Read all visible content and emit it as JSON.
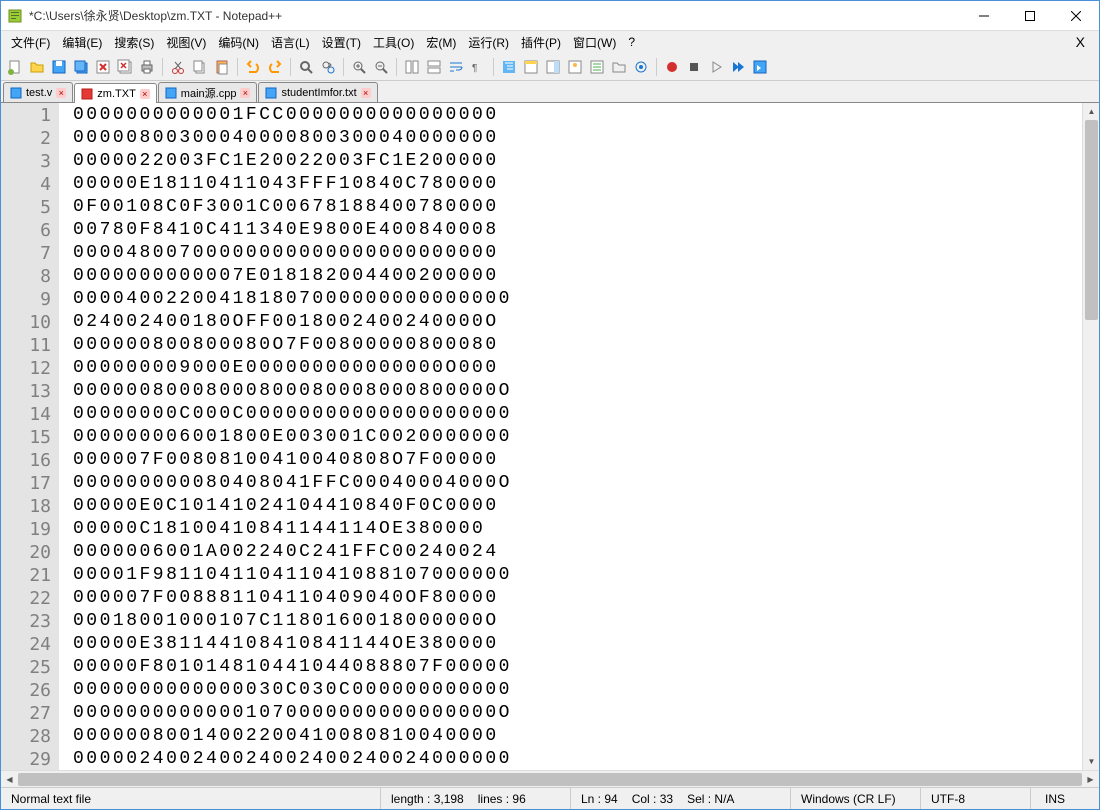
{
  "window": {
    "title": "*C:\\Users\\徐永贤\\Desktop\\zm.TXT - Notepad++"
  },
  "menu": {
    "items": [
      "文件(F)",
      "编辑(E)",
      "搜索(S)",
      "视图(V)",
      "编码(N)",
      "语言(L)",
      "设置(T)",
      "工具(O)",
      "宏(M)",
      "运行(R)",
      "插件(P)",
      "窗口(W)",
      "?"
    ]
  },
  "tabs": [
    {
      "label": "test.v",
      "active": false
    },
    {
      "label": "zm.TXT",
      "active": true
    },
    {
      "label": "main源.cpp",
      "active": false
    },
    {
      "label": "studentImfor.txt",
      "active": false
    }
  ],
  "editor": {
    "lines": [
      "0000000000001FCC0000000000000000",
      "00000800300040000800300040000000",
      "0000022003FC1E20022003FC1E200000",
      "00000E18110411043FFF10840C780000",
      "0F00108C0F3001C00678188400780000",
      "00780F8410C411340E9800E400840008",
      "00004800700000000000000000000000",
      "0000000000007E018182004400200000",
      "000040022004181807000000000000000",
      "024002400180OFF0018002400240000O",
      "000000800800080O7F00800000800080",
      "000000009000E000000000000000O000",
      "00000080008000800080008000800000O",
      "00000000C000C00000000000000000000",
      "000000006001800E003001C0020000000",
      "000007F00808100410040808O7F00000",
      "000000000080408041FFC00040004000O",
      "00000E0C10141024104410840F0C0000",
      "00000C18100410841144114OE380000",
      "0000006001A002240C241FFC00240024",
      "00001F981104110411041088107000000",
      "000007F008881104110409040OF80000",
      "00018001000107C1180160018000000O",
      "00000E381144108410841144OE380000",
      "00000F801014810441044088807F00000",
      "0000000000000030C030C000000000000",
      "00000000000001070000000000000000O",
      "00000080014002200410080810040000",
      "000002400240024002400240024000000"
    ]
  },
  "status": {
    "filetype": "Normal text file",
    "length_label": "length : 3,198",
    "lines_label": "lines : 96",
    "ln": "Ln : 94",
    "col": "Col : 33",
    "sel": "Sel : N/A",
    "eol": "Windows (CR LF)",
    "encoding": "UTF-8",
    "mode": "INS"
  }
}
